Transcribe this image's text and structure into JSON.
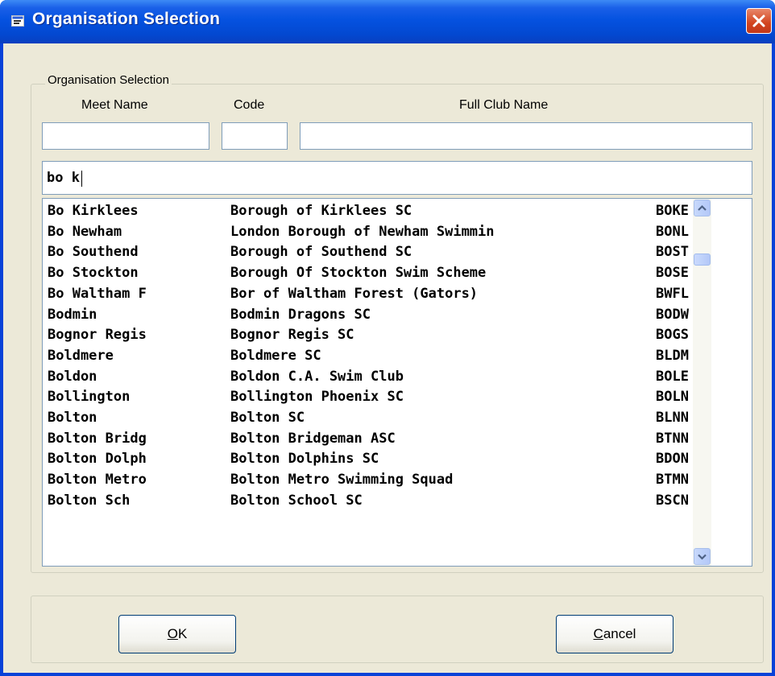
{
  "window": {
    "title": "Organisation Selection",
    "accent": "#0552e0",
    "close_color": "#d2441f"
  },
  "group": {
    "legend": "Organisation Selection",
    "columns": {
      "meet_name": "Meet Name",
      "code": "Code",
      "full_club_name": "Full Club Name"
    },
    "fields": {
      "meet_name_value": "",
      "code_value": "",
      "full_club_name_value": ""
    }
  },
  "search": {
    "value": "bo k"
  },
  "list": {
    "rows": [
      {
        "meet": "Bo Kirklees",
        "full": "Borough of Kirklees SC",
        "code": "BOKE"
      },
      {
        "meet": "Bo Newham",
        "full": "London Borough of Newham Swimmin",
        "code": "BONL"
      },
      {
        "meet": "Bo Southend",
        "full": "Borough of Southend SC",
        "code": "BOST"
      },
      {
        "meet": "Bo Stockton",
        "full": "Borough Of Stockton Swim Scheme",
        "code": "BOSE"
      },
      {
        "meet": "Bo Waltham F",
        "full": "Bor of Waltham Forest (Gators)",
        "code": "BWFL"
      },
      {
        "meet": "Bodmin",
        "full": "Bodmin Dragons SC",
        "code": "BODW"
      },
      {
        "meet": "Bognor Regis",
        "full": "Bognor Regis SC",
        "code": "BOGS"
      },
      {
        "meet": "Boldmere",
        "full": "Boldmere SC",
        "code": "BLDM"
      },
      {
        "meet": "Boldon",
        "full": "Boldon C.A. Swim Club",
        "code": "BOLE"
      },
      {
        "meet": "Bollington",
        "full": "Bollington Phoenix SC",
        "code": "BOLN"
      },
      {
        "meet": "Bolton",
        "full": "Bolton SC",
        "code": "BLNN"
      },
      {
        "meet": "Bolton Bridg",
        "full": "Bolton Bridgeman ASC",
        "code": "BTNN"
      },
      {
        "meet": "Bolton Dolph",
        "full": "Bolton Dolphins SC",
        "code": "BDON"
      },
      {
        "meet": "Bolton Metro",
        "full": "Bolton Metro Swimming Squad",
        "code": "BTMN"
      },
      {
        "meet": "Bolton Sch",
        "full": "Bolton School SC",
        "code": "BSCN"
      }
    ]
  },
  "buttons": {
    "ok_mnemonic": "O",
    "ok_rest": "K",
    "cancel_mnemonic": "C",
    "cancel_rest": "ancel"
  },
  "icons": {
    "title": "window-app-icon",
    "close": "close-x-icon",
    "scroll_up": "arrow-up-icon",
    "scroll_down": "arrow-down-icon"
  }
}
